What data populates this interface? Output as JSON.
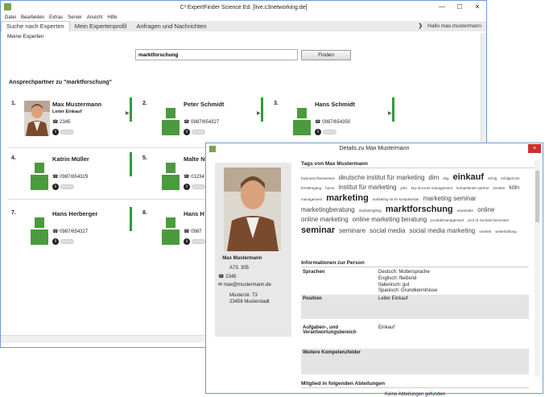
{
  "main_window": {
    "title": "C³ ExpertFinder Science Ed. [live.c3networking.de]",
    "menu": [
      "Datei",
      "Bearbeiten",
      "Extras",
      "Server",
      "Ansicht",
      "Hilfe"
    ],
    "tabs": [
      {
        "label": "Suche nach Experten",
        "active": true
      },
      {
        "label": "Mein Expertenprofil",
        "active": false
      },
      {
        "label": "Anfragen und Nachrichten",
        "active": false
      }
    ],
    "greeting": "Hallo max.mustermann",
    "subnav": "Meine Experten",
    "search": {
      "value": "marktforschung",
      "button": "Finden"
    },
    "results_title": "Ansprechpartner zu \"marktforschung\"",
    "results": [
      {
        "num": "1.",
        "name": "Max Mustermann",
        "role": "Leiter Einkauf",
        "phone": "2345",
        "photo": true
      },
      {
        "num": "2.",
        "name": "Peter Schmidt",
        "role": "",
        "phone": "0987/654327",
        "photo": false
      },
      {
        "num": "3.",
        "name": "Hans Schmidt",
        "role": "",
        "phone": "0987/654350",
        "photo": false
      },
      {
        "num": "4.",
        "name": "Katrin Müller",
        "role": "",
        "phone": "0987/654329",
        "photo": false
      },
      {
        "num": "5.",
        "name": "Malte N",
        "role": "",
        "phone": "01234",
        "photo": false
      },
      {
        "num": "7.",
        "name": "Hans Herberger",
        "role": "",
        "phone": "0987/654327",
        "photo": false
      },
      {
        "num": "8.",
        "name": "Hans H",
        "role": "",
        "phone": "0987",
        "photo": false
      }
    ]
  },
  "detail": {
    "title": "Details zu Max Mustermann",
    "close_icon": "×",
    "person": {
      "name": "Max Mustermann",
      "room": "A73. 305",
      "phone": "2345",
      "email": "max@mustermann.de",
      "street": "Musterstr. 73",
      "city": "23456 Musterstadt"
    },
    "tags_heading": "Tags von Max Mustermann",
    "tags": [
      {
        "t": "business-fitnessstest",
        "s": 4.5
      },
      {
        "t": "deutsche institut für marketing",
        "s": 8
      },
      {
        "t": "dim",
        "s": 8
      },
      {
        "t": "dsg",
        "s": 4.5
      },
      {
        "t": "einkauf",
        "s": 11,
        "b": true
      },
      {
        "t": "erfolg",
        "s": 4.5
      },
      {
        "t": "erfolgreiche",
        "s": 4.5
      },
      {
        "t": "fernlehrgang",
        "s": 4.5
      },
      {
        "t": "home",
        "s": 4.5
      },
      {
        "t": "institut für marketing",
        "s": 8
      },
      {
        "t": "jobs",
        "s": 4.5
      },
      {
        "t": "key account management",
        "s": 4.5
      },
      {
        "t": "kompetenter partner",
        "s": 4.5
      },
      {
        "t": "kunden",
        "s": 4.5
      },
      {
        "t": "köln",
        "s": 7
      },
      {
        "t": "management",
        "s": 4.5
      },
      {
        "t": "marketing",
        "s": 11,
        "b": true
      },
      {
        "t": "marketing ist ihr kompetenter",
        "s": 4.5
      },
      {
        "t": "marketing seminar",
        "s": 8
      },
      {
        "t": "marketingberatung",
        "s": 8
      },
      {
        "t": "marketingblog",
        "s": 4.5
      },
      {
        "t": "marktforschung",
        "s": 11,
        "b": true
      },
      {
        "t": "newsletter",
        "s": 4.5
      },
      {
        "t": "online",
        "s": 8
      },
      {
        "t": "online marketing",
        "s": 8
      },
      {
        "t": "online marketing beratung",
        "s": 8
      },
      {
        "t": "produktmanagement",
        "s": 4.5
      },
      {
        "t": "prof dr michael bernecker",
        "s": 4.5
      },
      {
        "t": "seminar",
        "s": 11,
        "b": true
      },
      {
        "t": "seminare",
        "s": 8
      },
      {
        "t": "social media",
        "s": 8
      },
      {
        "t": "social media marketing",
        "s": 8
      },
      {
        "t": "vertrieb",
        "s": 4.5
      },
      {
        "t": "weiterbildung",
        "s": 4.5
      }
    ],
    "info_heading": "Informationen zur Person",
    "rows": [
      {
        "label": "Sprachen",
        "value": [
          "Deutsch: Muttersprache",
          "Englisch: fließend",
          "Italienisch: gut",
          "Spanisch: Grundkenntnisse"
        ]
      },
      {
        "label": "Position",
        "value": [
          "Leiter Einkauf"
        ]
      },
      {
        "label": "Aufgaben-, und Verantwortungsbereich",
        "value": [
          "Einkauf"
        ]
      },
      {
        "label": "Weitere Kompetenzfelder",
        "value": [
          ""
        ]
      }
    ],
    "dept_heading": "Mitglied in folgenden Abteilungen",
    "dept_none": "Keine Abteilungen gefunden"
  }
}
